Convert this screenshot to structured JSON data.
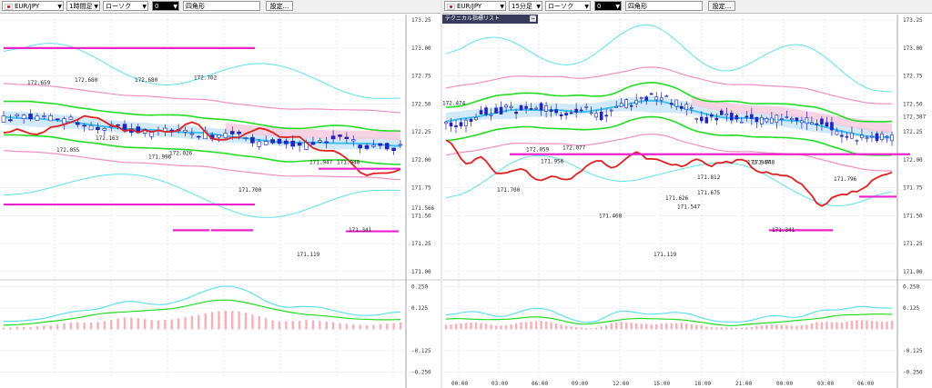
{
  "left": {
    "toolbar": {
      "symbol": "EUR/JPY",
      "timeframe": "1時間足",
      "chart_type": "ローソク",
      "indicator_value": "0",
      "shape": "四角形",
      "settings_label": "設定..."
    },
    "price_axis": [
      "173.25",
      "173.00",
      "172.75",
      "172.50",
      "172.25",
      "172.00",
      "171.75",
      "171.50",
      "171.25",
      "171.00"
    ],
    "current_price": "171.566",
    "osc_axis": [
      "0.250",
      "0.125",
      "-0.125",
      "-0.250"
    ],
    "point_labels": [
      "172.659",
      "172.680",
      "172.680",
      "172.702",
      "172.055",
      "172.163",
      "172.026",
      "171.996",
      "171.947",
      "171.948",
      "171.700",
      "171.341",
      "171.119"
    ]
  },
  "right": {
    "toolbar": {
      "symbol": "EUR/JPY",
      "timeframe": "15分足",
      "chart_type": "ローソク",
      "indicator_value": "0",
      "shape": "四角形",
      "settings_label": "設定..."
    },
    "popup_title": "テクニカル指標リスト",
    "popup_min": "−",
    "price_axis": [
      "173.25",
      "173.00",
      "172.75",
      "172.50",
      "172.387",
      "172.25",
      "172.00",
      "171.75",
      "171.50",
      "171.25",
      "171.00"
    ],
    "osc_axis": [
      "0.250",
      "0.125",
      "-0.125",
      "-0.250"
    ],
    "point_labels": [
      "172.474",
      "172.059",
      "172.077",
      "171.956",
      "171.700",
      "171.547",
      "171.947",
      "171.948",
      "171.812",
      "171.796",
      "171.675",
      "171.626",
      "171.468",
      "171.341",
      "171.119"
    ],
    "time_axis": [
      "00:00",
      "03:00",
      "06:00",
      "09:00",
      "12:00",
      "15:00",
      "18:00",
      "21:00",
      "00:00",
      "03:00",
      "06:00"
    ]
  },
  "colors": {
    "band_outer": "#5ee0f0",
    "band_pink": "#f090c0",
    "band_green": "#22dd22",
    "ma_blue": "#40c0f0",
    "line_red": "#e02020",
    "hline_magenta": "#ee22cc",
    "candle_up": "#ffffff",
    "candle_down": "#2222cc",
    "macd_hist": "#f6b0b8",
    "cloud_blue": "#bfe0f6",
    "cloud_pink": "#f6c8dc"
  }
}
